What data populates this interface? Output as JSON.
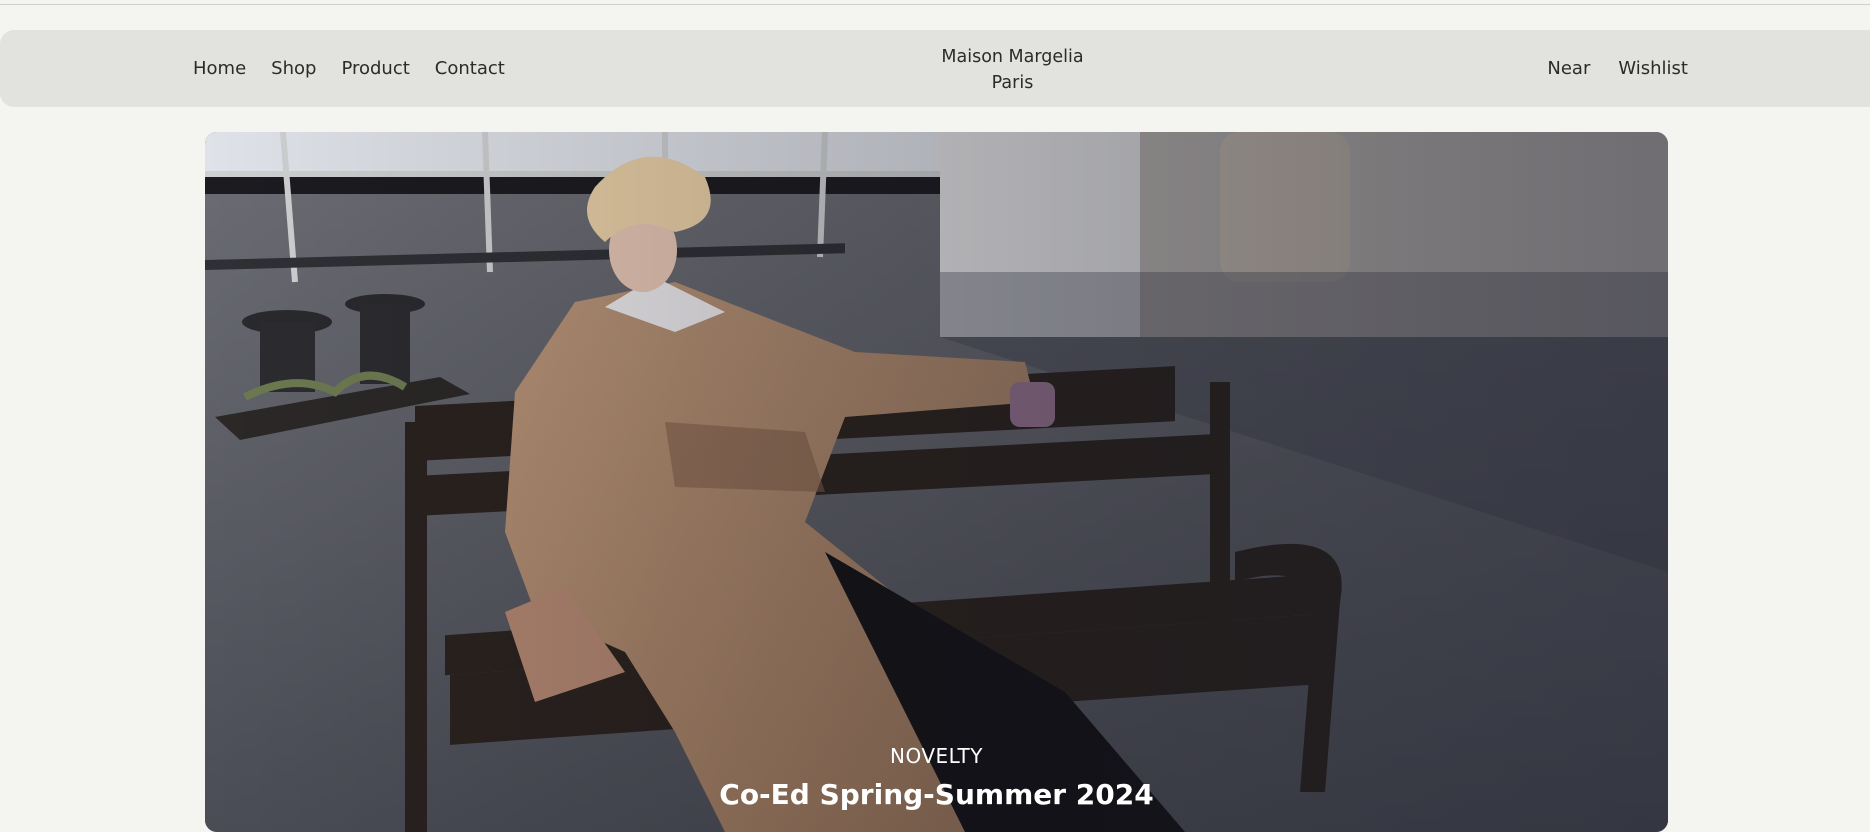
{
  "nav": {
    "left_links": [
      "Home",
      "Shop",
      "Product",
      "Contact"
    ],
    "brand_line1": "Maison Margelia",
    "brand_line2": "Paris",
    "right_links": [
      "Near",
      "Wishlist"
    ]
  },
  "hero": {
    "kicker": "NOVELTY",
    "headline": "Co-Ed Spring-Summer 2024"
  }
}
